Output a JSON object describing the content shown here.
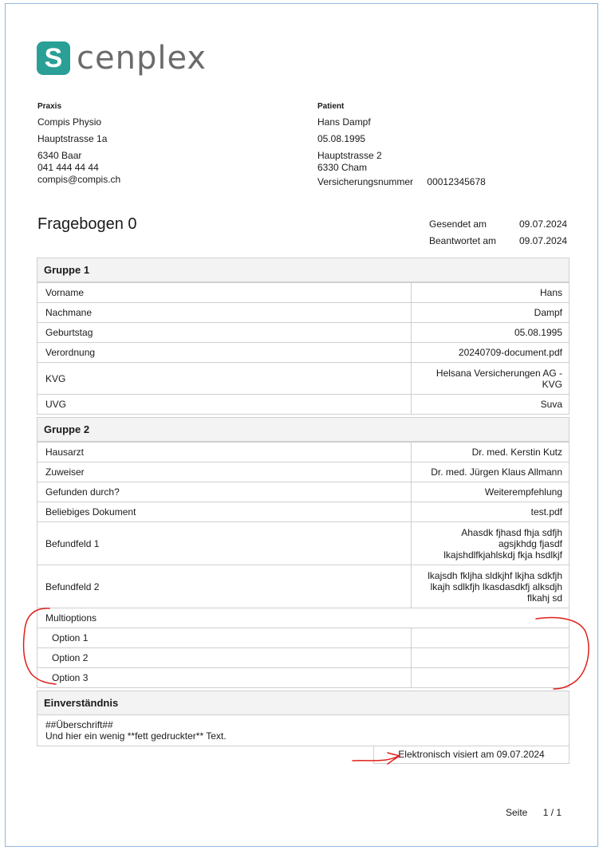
{
  "logo": {
    "glyph": "S",
    "text": "cenplex"
  },
  "praxis": {
    "heading": "Praxis",
    "name": "Compis Physio",
    "street": "Hauptstrasse 1a",
    "city": "6340 Baar",
    "phone": "041 444 44 44",
    "email": "compis@compis.ch"
  },
  "patient": {
    "heading": "Patient",
    "name": "Hans Dampf",
    "birthdate": "05.08.1995",
    "street": "Hauptstrasse 2",
    "city": "6330 Cham",
    "insurance_label": "Versicherungsnummer",
    "insurance_number": "00012345678"
  },
  "title": "Fragebogen 0",
  "dates": {
    "sent_label": "Gesendet am",
    "sent_value": "09.07.2024",
    "answered_label": "Beantwortet am",
    "answered_value": "09.07.2024"
  },
  "groups": [
    {
      "title": "Gruppe 1",
      "rows": [
        {
          "label": "Vorname",
          "value": "Hans"
        },
        {
          "label": "Nachmane",
          "value": "Dampf"
        },
        {
          "label": "Geburtstag",
          "value": "05.08.1995"
        },
        {
          "label": "Verordnung",
          "value": "20240709-document.pdf"
        },
        {
          "label": "KVG",
          "value": "Helsana Versicherungen AG - KVG"
        },
        {
          "label": "UVG",
          "value": "Suva"
        }
      ]
    },
    {
      "title": "Gruppe 2",
      "rows": [
        {
          "label": "Hausarzt",
          "value": "Dr. med. Kerstin Kutz"
        },
        {
          "label": "Zuweiser",
          "value": "Dr. med. Jürgen Klaus Allmann"
        },
        {
          "label": "Gefunden durch?",
          "value": "Weiterempfehlung"
        },
        {
          "label": "Beliebiges Dokument",
          "value": "test.pdf"
        },
        {
          "label": "Befundfeld 1",
          "value": "Ahasdk fjhasd fhja sdfjh agsjkhdg fjasdf lkajshdlfkjahlskdj fkja hsdlkjf"
        },
        {
          "label": "Befundfeld 2",
          "value": "lkajsdh fkljha sldkjhf lkjha sdkfjh lkajh sdlkfjh lkasdasdkfj alksdjh flkahj sd"
        }
      ],
      "multi_label": "Multioptions",
      "options": [
        {
          "label": "Option 1",
          "value": ""
        },
        {
          "label": "Option 2",
          "value": ""
        },
        {
          "label": "Option 3",
          "value": ""
        }
      ]
    }
  ],
  "consent": {
    "title": "Einverständnis",
    "line1": "##Überschrift##",
    "line2": "Und hier ein wenig **fett gedruckter** Text."
  },
  "visum": "Elektronisch visiert am 09.07.2024",
  "footer": {
    "page_label": "Seite",
    "page_value": "1 / 1"
  },
  "colors": {
    "brand": "#2a9f95",
    "annotation": "#e0201b"
  }
}
